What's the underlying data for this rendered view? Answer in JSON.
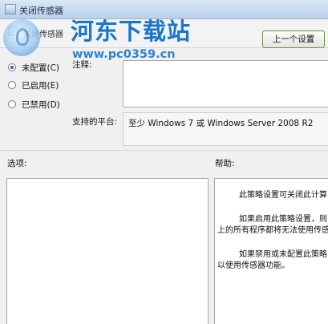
{
  "window": {
    "title": "关闭传感器"
  },
  "header": {
    "setting_name": "关闭传感器",
    "prev_button": "上一个设置"
  },
  "watermark": {
    "name": "河东下载站",
    "url": "www.pc0359.cn"
  },
  "radios": [
    {
      "label": "未配置(C)",
      "checked": true
    },
    {
      "label": "已启用(E)",
      "checked": false
    },
    {
      "label": "已禁用(D)",
      "checked": false
    }
  ],
  "comment": {
    "label": "注释:"
  },
  "platform": {
    "label": "支持的平台:",
    "value": "至少 Windows 7 或 Windows Server 2008 R2"
  },
  "options": {
    "label": "选项:"
  },
  "help": {
    "label": "帮助:",
    "p1": "此策略设置可关闭此计算",
    "p2_line1": "如果启用此策略设置，则",
    "p2_line2": "上的所有程序都将无法使用传感",
    "p3_line1": "如果禁用或未配置此策略",
    "p3_line2": "以使用传感器功能。"
  }
}
